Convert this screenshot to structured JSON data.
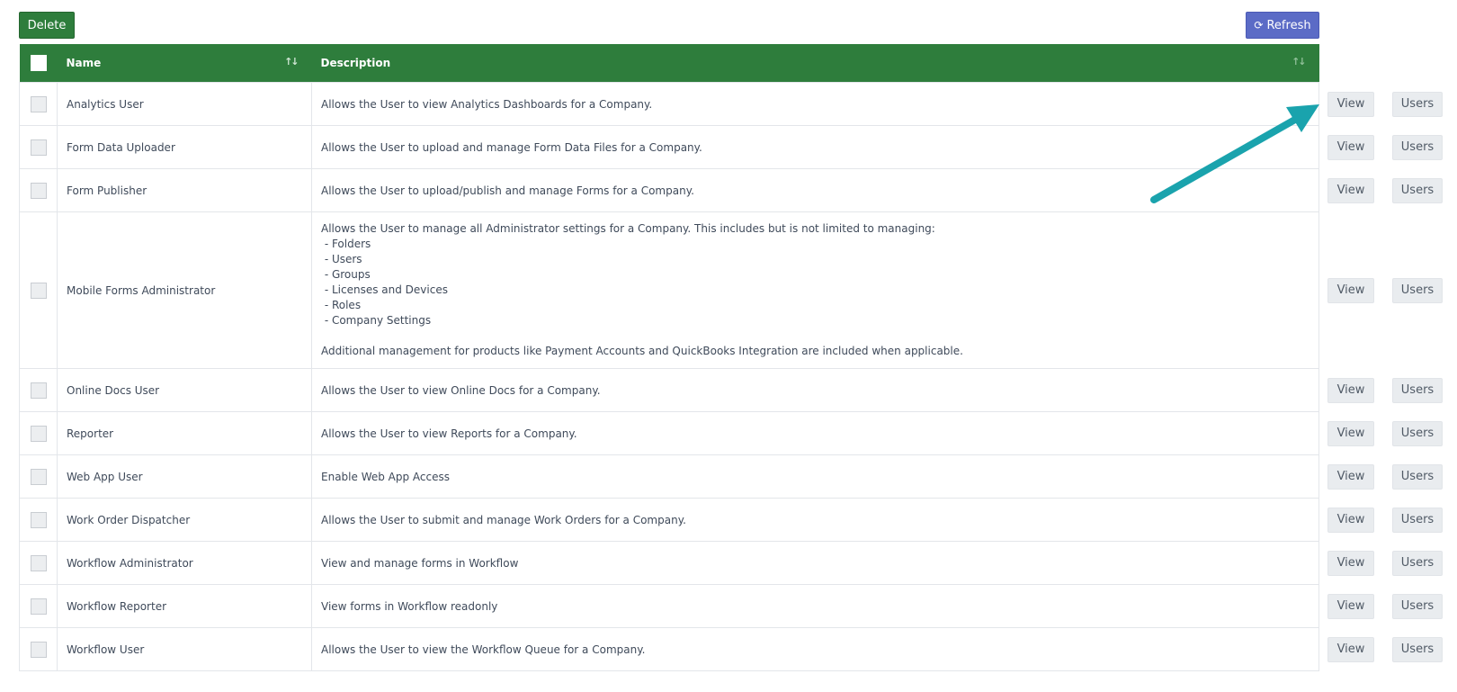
{
  "toolbar": {
    "delete_label": "Delete",
    "refresh_label": "Refresh",
    "refresh_icon": "refresh-icon"
  },
  "table": {
    "columns": {
      "name": "Name",
      "description": "Description"
    },
    "sort_icon": "↑↓",
    "row_actions": {
      "view_label": "View",
      "users_label": "Users"
    },
    "rows": [
      {
        "name": "Analytics User",
        "description": [
          "Allows the User to view Analytics Dashboards for a Company."
        ]
      },
      {
        "name": "Form Data Uploader",
        "description": [
          "Allows the User to upload and manage Form Data Files for a Company."
        ]
      },
      {
        "name": "Form Publisher",
        "description": [
          "Allows the User to upload/publish and manage Forms for a Company."
        ]
      },
      {
        "name": "Mobile Forms Administrator",
        "description": [
          "Allows the User to manage all Administrator settings for a Company. This includes but is not limited to managing:",
          " - Folders",
          " - Users",
          " - Groups",
          " - Licenses and Devices",
          " - Roles",
          " - Company Settings",
          "",
          "Additional management for products like Payment Accounts and QuickBooks Integration are included when applicable."
        ]
      },
      {
        "name": "Online Docs User",
        "description": [
          "Allows the User to view Online Docs for a Company."
        ]
      },
      {
        "name": "Reporter",
        "description": [
          "Allows the User to view Reports for a Company."
        ]
      },
      {
        "name": "Web App User",
        "description": [
          "Enable Web App Access"
        ]
      },
      {
        "name": "Work Order Dispatcher",
        "description": [
          "Allows the User to submit and manage Work Orders for a Company."
        ]
      },
      {
        "name": "Workflow Administrator",
        "description": [
          "View and manage forms in Workflow"
        ]
      },
      {
        "name": "Workflow Reporter",
        "description": [
          "View forms in Workflow readonly"
        ]
      },
      {
        "name": "Workflow User",
        "description": [
          "Allows the User to view the Workflow Queue for a Company."
        ]
      }
    ]
  },
  "colors": {
    "header_green": "#2e7d3c",
    "refresh_blue": "#5b6bc6",
    "annotation_arrow": "#1aa3ad"
  }
}
